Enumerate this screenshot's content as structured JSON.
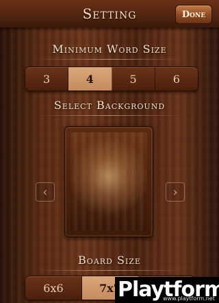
{
  "header": {
    "title": "Setting",
    "done_label": "Done"
  },
  "minimum_word_size": {
    "label": "Minimum Word Size",
    "options": [
      "3",
      "4",
      "5",
      "6"
    ],
    "selected": "4"
  },
  "background": {
    "label": "Select Background",
    "prev_icon": "chevron-left-icon",
    "next_icon": "chevron-right-icon"
  },
  "board_size": {
    "label": "Board Size",
    "options": [
      "6x6",
      "7x7"
    ],
    "selected": "7x7"
  },
  "watermark": {
    "text": "Playtform",
    "url": "www.playtform.net"
  },
  "colors": {
    "header_text": "#f3e2c8",
    "selected_segment": "#d9a77c"
  }
}
